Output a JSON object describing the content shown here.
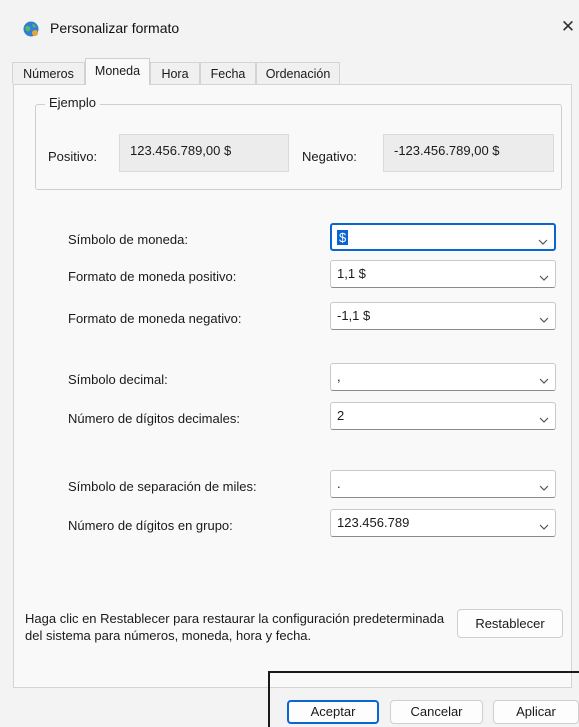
{
  "window": {
    "title": "Personalizar formato",
    "close_label": "✕"
  },
  "tabs": [
    {
      "label": "Números"
    },
    {
      "label": "Moneda"
    },
    {
      "label": "Hora"
    },
    {
      "label": "Fecha"
    },
    {
      "label": "Ordenación"
    }
  ],
  "active_tab": "Moneda",
  "example": {
    "legend": "Ejemplo",
    "positive_label": "Positivo:",
    "positive_value": "123.456.789,00 $",
    "negative_label": "Negativo:",
    "negative_value": "-123.456.789,00 $"
  },
  "settings": [
    {
      "label": "Símbolo de moneda:",
      "value": "$"
    },
    {
      "label": "Formato de moneda positivo:",
      "value": "1,1 $"
    },
    {
      "label": "Formato de moneda negativo:",
      "value": "-1,1 $"
    },
    {
      "label": "Símbolo decimal:",
      "value": ","
    },
    {
      "label": "Número de dígitos decimales:",
      "value": "2"
    },
    {
      "label": "Símbolo de separación de miles:",
      "value": "."
    },
    {
      "label": "Número de dígitos en grupo:",
      "value": "123.456.789"
    }
  ],
  "hint": "Haga clic en Restablecer para restaurar la configuración predeterminada del sistema para números, moneda, hora y fecha.",
  "buttons": {
    "reset": "Restablecer",
    "ok": "Aceptar",
    "cancel": "Cancelar",
    "apply": "Aplicar"
  },
  "colors": {
    "accent": "#0a64d2",
    "background": "#f3f3f3",
    "panel": "#f9f9f9"
  }
}
